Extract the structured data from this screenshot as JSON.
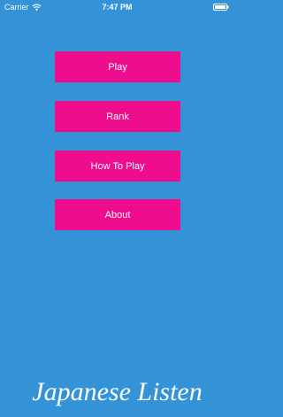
{
  "status_bar": {
    "carrier": "Carrier",
    "time": "7:47 PM",
    "wifi_icon": "wifi-icon",
    "battery_icon": "battery-icon"
  },
  "menu": {
    "play_label": "Play",
    "rank_label": "Rank",
    "how_to_play_label": "How To Play",
    "about_label": "About"
  },
  "app_title": "Japanese Listen",
  "colors": {
    "background": "#3393d6",
    "button": "#ee0d8c",
    "text": "#ffffff"
  }
}
